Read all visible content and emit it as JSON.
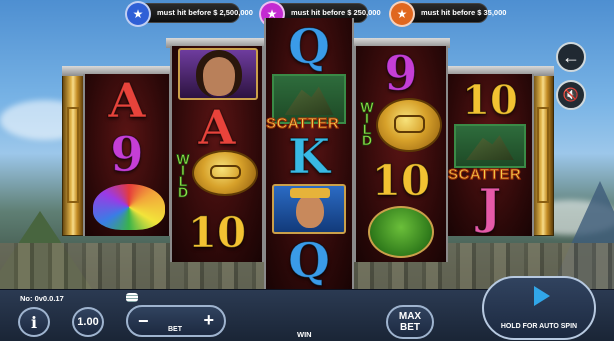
{
  "jackpots": [
    {
      "text": "must hit before $ 2,500,000",
      "color": "#2f5fd6",
      "star_color": "#2f5fd6"
    },
    {
      "text": "must hit before $ 250,000",
      "color": "#c42ad1",
      "star_color": "#c42ad1"
    },
    {
      "text": "must hit before $ 35,000",
      "color": "#e0671f",
      "star_color": "#e0671f"
    }
  ],
  "reels": {
    "reel1": {
      "top": "A",
      "middle": "9",
      "bottom": "hat"
    },
    "reel2": {
      "top": "woman-portrait",
      "middle": "A",
      "wild": "WILD",
      "bottom": "10"
    },
    "reel3": {
      "top": "Q",
      "scatter": "SCATTER",
      "middle": "K",
      "portrait": "inca-portrait",
      "bottom": "Q"
    },
    "reel4": {
      "top": "9",
      "wild": "WILD",
      "middle": "10",
      "bottom": "llama"
    },
    "reel5": {
      "top": "10",
      "scatter": "SCATTER",
      "bottom": "J"
    }
  },
  "symbols": {
    "a": "A",
    "nine": "9",
    "ten": "10",
    "q": "Q",
    "k": "K",
    "j": "J",
    "scatter": "SCATTER",
    "wild": "WILD"
  },
  "controls": {
    "back_icon": "arrow-left-icon",
    "mute_icon": "speaker-muted-icon",
    "version": "No: 0v0.0.17",
    "info_label": "i",
    "coin_value": "1.00",
    "bet_minus": "−",
    "bet_plus": "+",
    "bet_label": "BET",
    "win_label": "WIN",
    "max_bet_line1": "MAX",
    "max_bet_line2": "BET",
    "spin_hint": "HOLD FOR AUTO SPIN",
    "coins_icon": "coin-stack-icon"
  }
}
